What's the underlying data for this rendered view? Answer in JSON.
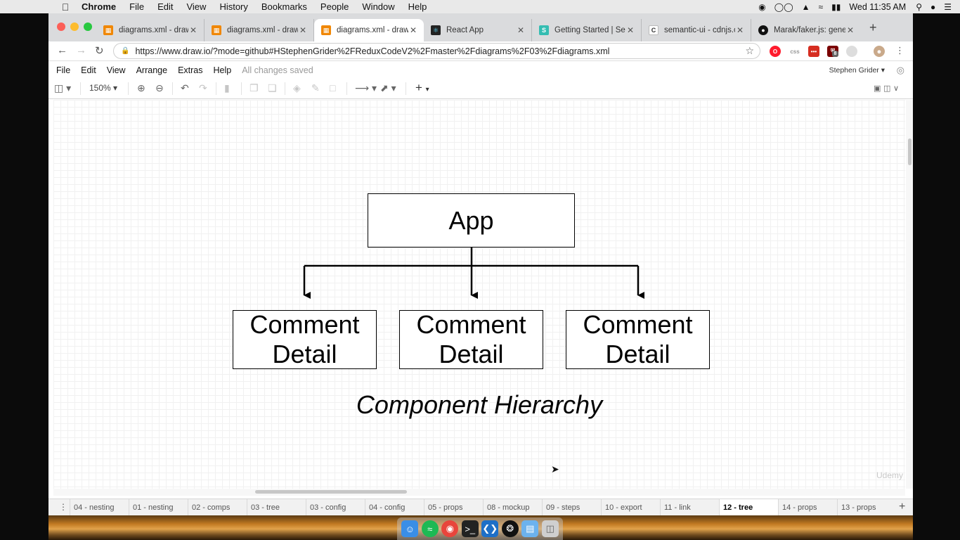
{
  "menubar": {
    "app": "Chrome",
    "items": [
      "File",
      "Edit",
      "View",
      "History",
      "Bookmarks",
      "People",
      "Window",
      "Help"
    ],
    "clock": "Wed 11:35 AM"
  },
  "tabs": [
    {
      "title": "diagrams.xml - draw",
      "icon": "drawio-icon",
      "active": false
    },
    {
      "title": "diagrams.xml - draw",
      "icon": "drawio-icon",
      "active": false
    },
    {
      "title": "diagrams.xml - draw",
      "icon": "drawio-icon",
      "active": true
    },
    {
      "title": "React App",
      "icon": "react-icon",
      "active": false
    },
    {
      "title": "Getting Started | Sen",
      "icon": "semantic-icon",
      "active": false
    },
    {
      "title": "semantic-ui - cdnjs.c",
      "icon": "cdnjs-icon",
      "active": false
    },
    {
      "title": "Marak/faker.js: gener",
      "icon": "github-icon",
      "active": false
    }
  ],
  "omnibox": {
    "url": "https://www.draw.io/?mode=github#HStephenGrider%2FReduxCodeV2%2Fmaster%2Fdiagrams%2F03%2Fdiagrams.xml"
  },
  "extensions": {
    "css_label": "css",
    "badge": "8"
  },
  "drawio": {
    "menu": [
      "File",
      "Edit",
      "View",
      "Arrange",
      "Extras",
      "Help"
    ],
    "status": "All changes saved",
    "user": "Stephen Grider",
    "zoom": "150%"
  },
  "diagram": {
    "root": "App",
    "children": [
      "Comment\nDetail",
      "Comment\nDetail",
      "Comment\nDetail"
    ],
    "caption": "Component Hierarchy",
    "watermark": "Udemy"
  },
  "pages": {
    "tabs": [
      "04 - nesting",
      "01 - nesting",
      "02 - comps",
      "03 - tree",
      "03 - config",
      "04 - config",
      "05 - props",
      "08 - mockup",
      "09 - steps",
      "10 - export",
      "11 - link",
      "12 - tree",
      "14 - props",
      "13 - props"
    ],
    "selected_index": 11
  },
  "colors": {
    "close": "#fc5f57",
    "minimize": "#fdbc2e",
    "maximize": "#28c840",
    "drawio": "#f08705"
  }
}
